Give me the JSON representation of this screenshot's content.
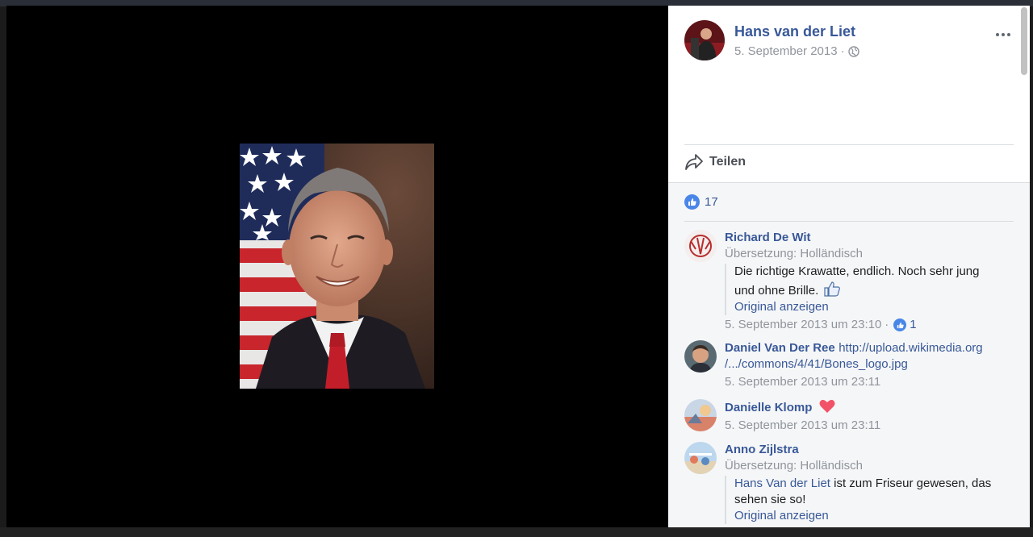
{
  "post": {
    "author": "Hans van der Liet",
    "date": "5. September 2013",
    "meta_sep": "·",
    "share_label": "Teilen",
    "reaction_count": "17"
  },
  "comments": [
    {
      "name": "Richard De Wit",
      "translation": "Übersetzung: Holländisch",
      "text": "Die richtige Krawatte, endlich. Noch sehr jung und ohne Brille.",
      "original_link": "Original anzeigen",
      "timestamp": "5. September 2013 um 23:10",
      "time_sep": "·",
      "likes": "1"
    },
    {
      "name": "Daniel Van Der Ree",
      "link_text": "http://upload.wikimedia.org /.../commons/4/41/Bones_logo.jpg",
      "timestamp": "5. September 2013 um 23:11"
    },
    {
      "name": "Danielle Klomp",
      "timestamp": "5. September 2013 um 23:11"
    },
    {
      "name": "Anno Zijlstra",
      "translation": "Übersetzung: Holländisch",
      "mention": "Hans Van der Liet",
      "text": " ist zum Friseur gewesen, das sehen sie so!",
      "original_link": "Original anzeigen"
    }
  ],
  "colors": {
    "link": "#385898",
    "meta": "#90949c",
    "like_blue": "#4a86e8",
    "heart": "#f25268"
  }
}
